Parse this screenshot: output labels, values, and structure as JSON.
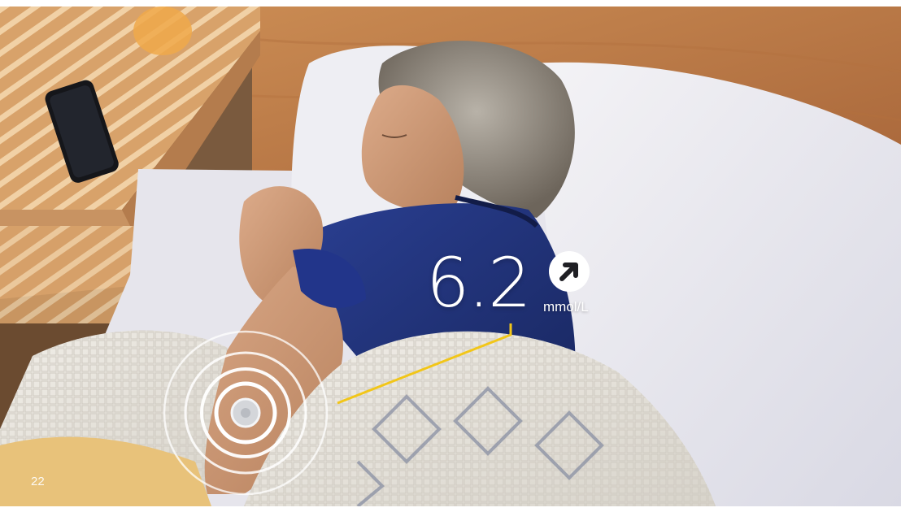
{
  "glucose": {
    "value": "6.2",
    "unit": "mmol/L",
    "trend_icon": "arrow-up-right-icon",
    "line_color": "#f2c618"
  },
  "page": {
    "number": "22"
  }
}
